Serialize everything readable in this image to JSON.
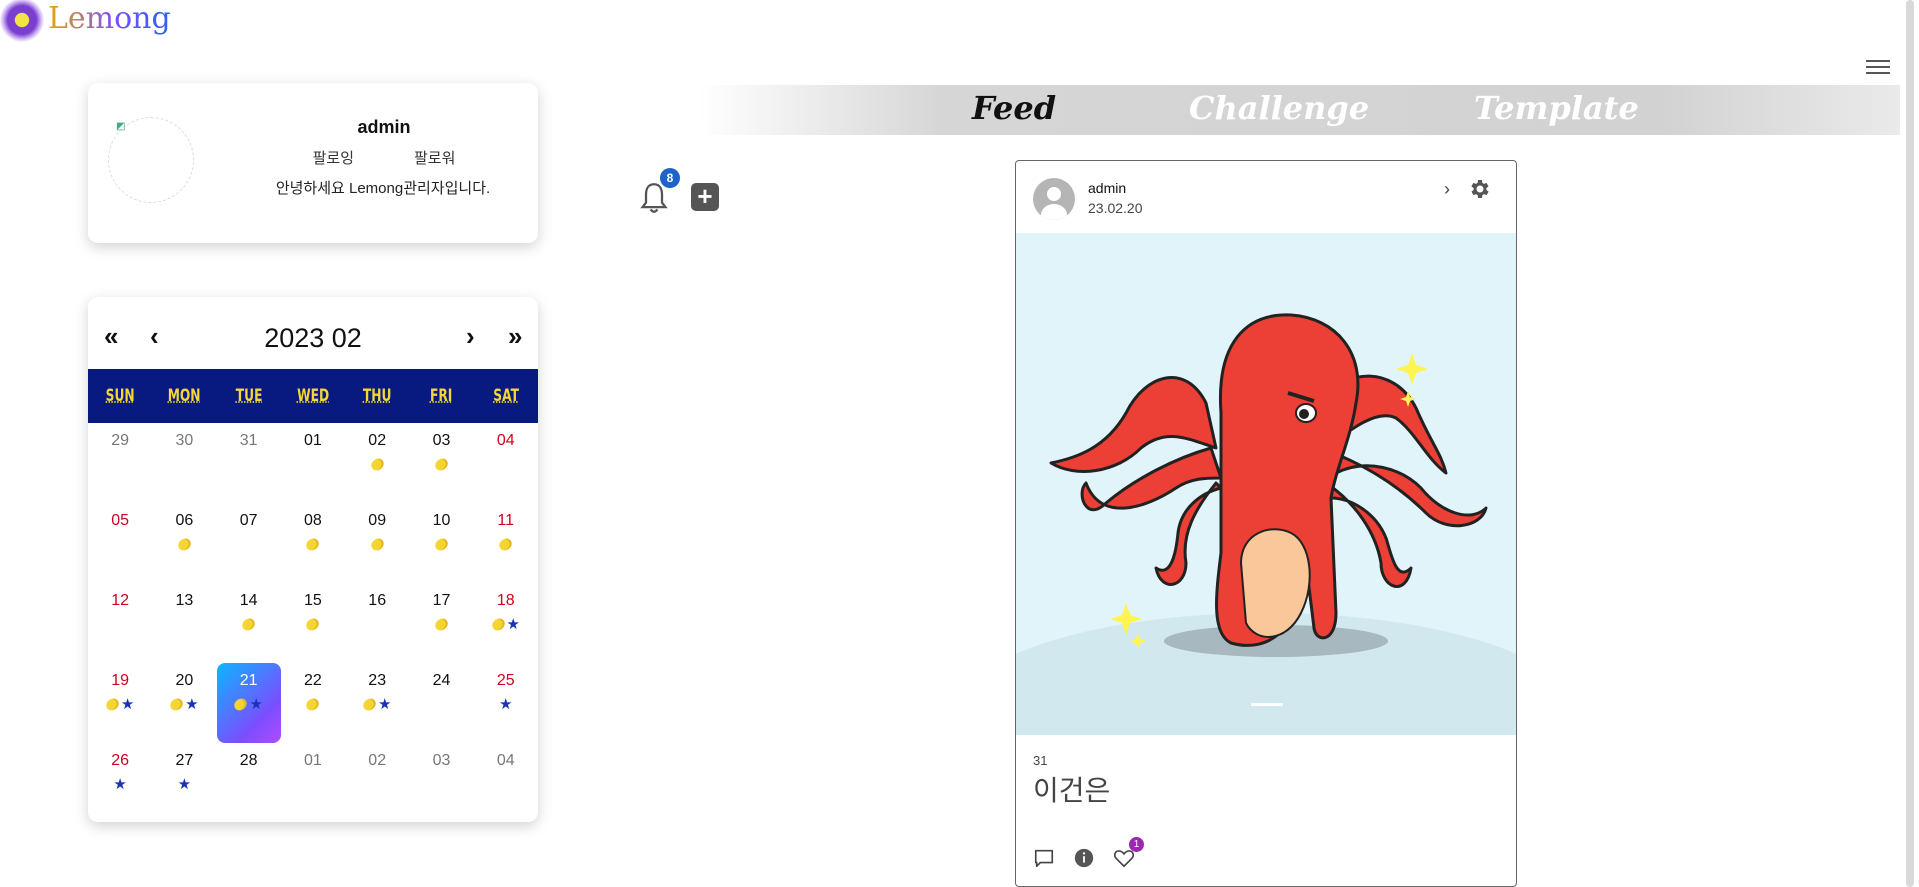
{
  "brand": {
    "name": "Lemong"
  },
  "profile": {
    "username": "admin",
    "following_label": "팔로잉",
    "follower_label": "팔로워",
    "bio": "안녕하세요 Lemong관리자입니다."
  },
  "calendar": {
    "title": "2023 02",
    "nav": {
      "prev_year": "«",
      "prev_month": "‹",
      "next_month": "›",
      "next_year": "»"
    },
    "weekdays": [
      "SUN",
      "MON",
      "TUE",
      "WED",
      "THU",
      "FRI",
      "SAT"
    ],
    "weeks": [
      [
        {
          "d": "29",
          "m": true
        },
        {
          "d": "30",
          "m": true
        },
        {
          "d": "31",
          "m": true
        },
        {
          "d": "01"
        },
        {
          "d": "02",
          "l": 1
        },
        {
          "d": "03",
          "l": 1
        },
        {
          "d": "04",
          "r": true
        }
      ],
      [
        {
          "d": "05",
          "r": true
        },
        {
          "d": "06",
          "l": 1
        },
        {
          "d": "07"
        },
        {
          "d": "08",
          "l": 1
        },
        {
          "d": "09",
          "l": 1
        },
        {
          "d": "10",
          "l": 1
        },
        {
          "d": "11",
          "r": true,
          "l": 1
        }
      ],
      [
        {
          "d": "12",
          "r": true
        },
        {
          "d": "13"
        },
        {
          "d": "14",
          "l": 1
        },
        {
          "d": "15",
          "l": 1
        },
        {
          "d": "16"
        },
        {
          "d": "17",
          "l": 1
        },
        {
          "d": "18",
          "r": true,
          "l": 1,
          "s": 1
        }
      ],
      [
        {
          "d": "19",
          "r": true,
          "l": 1,
          "s": 1
        },
        {
          "d": "20",
          "l": 1,
          "s": 1
        },
        {
          "d": "21",
          "today": true,
          "l": 1,
          "s": 1
        },
        {
          "d": "22",
          "l": 1
        },
        {
          "d": "23",
          "l": 1,
          "s": 1
        },
        {
          "d": "24"
        },
        {
          "d": "25",
          "r": true,
          "s": 1
        }
      ],
      [
        {
          "d": "26",
          "r": true,
          "s": 1
        },
        {
          "d": "27",
          "s": 1
        },
        {
          "d": "28"
        },
        {
          "d": "01",
          "m": true
        },
        {
          "d": "02",
          "m": true
        },
        {
          "d": "03",
          "m": true
        },
        {
          "d": "04",
          "m": true
        }
      ]
    ],
    "colors": {
      "header_bg": "#081a80",
      "header_text": "#f4d736",
      "weekend": "#d0021b",
      "star": "#1b32b8",
      "lemon": "#f5d532"
    }
  },
  "tabs": [
    {
      "label": "Feed",
      "active": true
    },
    {
      "label": "Challenge",
      "active": false
    },
    {
      "label": "Template",
      "active": false
    }
  ],
  "notifications": {
    "count": "8"
  },
  "post": {
    "username": "admin",
    "date": "23.02.20",
    "chevron": "›",
    "count": "31",
    "caption": "이건은",
    "like_count": "1"
  },
  "icons": [
    "hamburger-icon",
    "bell-icon",
    "add-icon",
    "gear-icon",
    "chevron-right-icon",
    "comment-icon",
    "info-icon",
    "heart-icon"
  ]
}
